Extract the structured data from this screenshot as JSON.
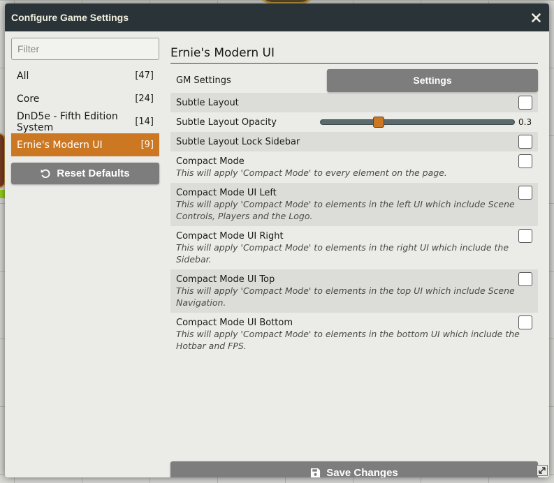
{
  "window": {
    "title": "Configure Game Settings"
  },
  "sidebar": {
    "filter_placeholder": "Filter",
    "items": [
      {
        "label": "All",
        "count": "[47]"
      },
      {
        "label": "Core",
        "count": "[24]"
      },
      {
        "label": "DnD5e - Fifth Edition System",
        "count": "[14]"
      },
      {
        "label": "Ernie's Modern UI",
        "count": "[9]",
        "active": true
      }
    ],
    "reset_label": "Reset Defaults"
  },
  "main": {
    "section_title": "Ernie's Modern UI",
    "gm_settings": {
      "label": "GM Settings",
      "button": "Settings"
    },
    "subtle_layout": {
      "label": "Subtle Layout"
    },
    "subtle_opacity": {
      "label": "Subtle Layout Opacity",
      "value": "0.3",
      "fraction": 0.3
    },
    "subtle_lock": {
      "label": "Subtle Layout Lock Sidebar"
    },
    "compact": {
      "label": "Compact Mode",
      "notes": "This will apply 'Compact Mode' to every element on the page."
    },
    "compact_left": {
      "label": "Compact Mode UI Left",
      "notes": "This will apply 'Compact Mode' to elements in the left UI which include Scene Controls, Players and the Logo."
    },
    "compact_right": {
      "label": "Compact Mode UI Right",
      "notes": "This will apply 'Compact Mode' to elements in the right UI which include the Sidebar."
    },
    "compact_top": {
      "label": "Compact Mode UI Top",
      "notes": "This will apply 'Compact Mode' to elements in the top UI which include Scene Navigation."
    },
    "compact_bottom": {
      "label": "Compact Mode UI Bottom",
      "notes": "This will apply 'Compact Mode' to elements in the bottom UI which include the Hotbar and FPS."
    },
    "save_label": "Save Changes"
  },
  "colors": {
    "accent": "#cc7722",
    "titlebar": "#2a3438",
    "button": "#7d7d7d"
  }
}
